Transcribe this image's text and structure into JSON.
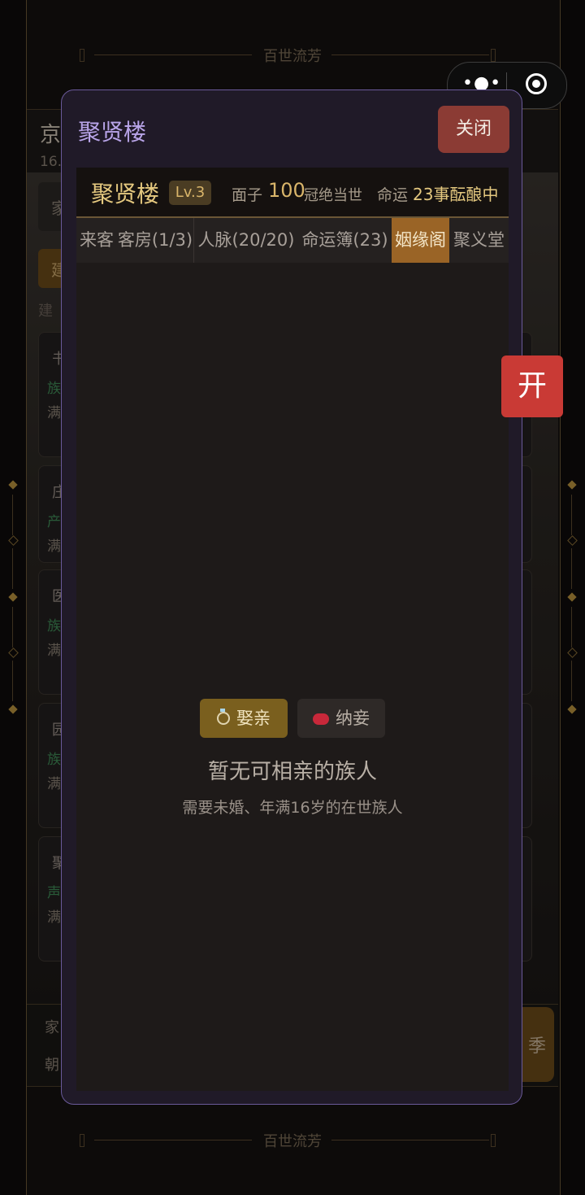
{
  "background": {
    "deco_title": "百世流芳",
    "header_city": "京",
    "header_sub": "16.",
    "cards": [
      {
        "t1": "书",
        "t2": "族",
        "t3": "满"
      },
      {
        "t1": "庄",
        "t2": "产",
        "t3": "满"
      },
      {
        "t1": "医",
        "t2": "族",
        "t3": "满"
      },
      {
        "t1": "园",
        "t2": "族",
        "t3": "满"
      },
      {
        "t1": "聚",
        "t2": "声",
        "t3": "满"
      }
    ],
    "left_labels": [
      "家",
      "建",
      "建"
    ],
    "footer": {
      "line1": "家",
      "line2": "朝"
    },
    "season_button": "季"
  },
  "capsule": {
    "more_icon": "more-dots-icon",
    "close_icon": "target-circle-icon"
  },
  "open_button": "开",
  "modal": {
    "title": "聚贤楼",
    "close_label": "关闭",
    "info": {
      "name": "聚贤楼",
      "level": "Lv.3",
      "face_label": "面子",
      "face_value": "100",
      "face_title": "冠绝当世",
      "fate_label": "命运",
      "fate_value": "23事酝酿中"
    },
    "tabs": [
      "来客",
      "客房(1/3)",
      "人脉(20/20)",
      "命运簿(23)",
      "姻缘阁",
      "聚义堂"
    ],
    "active_tab": "姻缘阁",
    "sub_tabs": {
      "marry": "娶亲",
      "concubine": "纳妾"
    },
    "empty_title": "暂无可相亲的族人",
    "empty_desc": "需要未婚、年满16岁的在世族人"
  }
}
